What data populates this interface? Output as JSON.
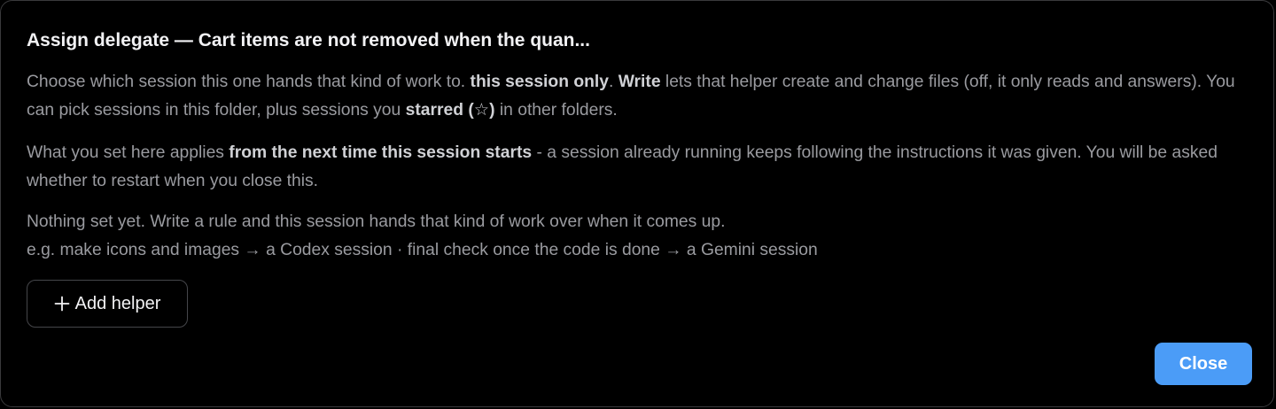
{
  "dialog": {
    "title": "Assign delegate — Cart items are not removed when the quan...",
    "intro": {
      "t1": "Choose which session this one hands that kind of work to. ",
      "b1": "this session only",
      "t2": ". ",
      "b2": "Write",
      "t3": " lets that helper create and change files (off, it only reads and answers). You can pick sessions in this folder, plus sessions you ",
      "b3": "starred (☆)",
      "t4": " in other folders."
    },
    "restart_note": {
      "t1": "What you set here applies ",
      "b1": "from the next time this session starts",
      "t2": " - a session already running keeps following the instructions it was given. You will be asked whether to restart when you close this."
    },
    "empty_state": {
      "line1": "Nothing set yet. Write a rule and this session hands that kind of work over when it comes up.",
      "line2": "e.g. make icons and images → a Codex session · final check once the code is done → a Gemini session"
    },
    "add_helper_label": "Add helper",
    "add_helper_icon": "plus-icon",
    "close_label": "Close"
  },
  "colors": {
    "background": "#000000",
    "title": "#f2f2f4",
    "body_text": "#9a9ba0",
    "emphasis": "#d0d1d5",
    "accent": "#4b9cf7",
    "border": "#3a3a3c"
  }
}
